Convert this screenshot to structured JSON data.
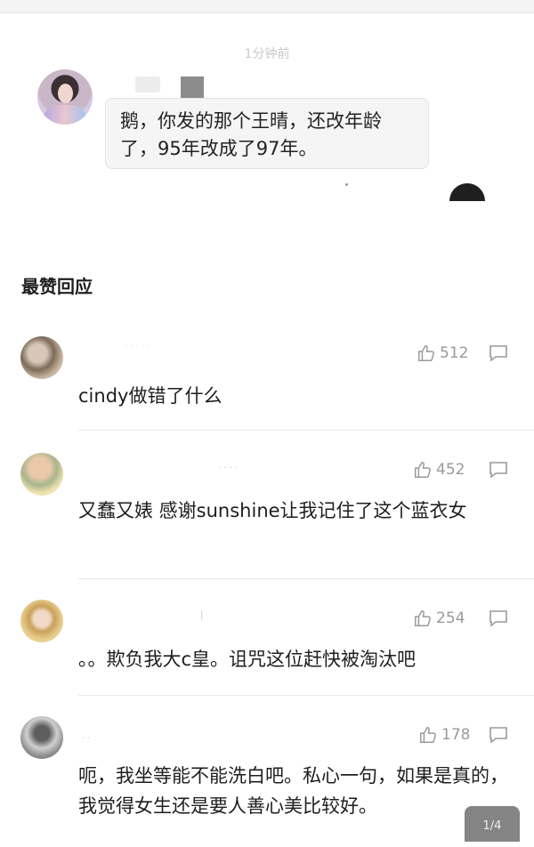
{
  "chat": {
    "timestamp": "1分钟前",
    "message": "鹅，你发的那个王晴，还改年龄了，95年改成了97年。"
  },
  "top_replies": {
    "title": "最赞回应",
    "comments": [
      {
        "likes": "512",
        "text": "cindy做错了什么"
      },
      {
        "likes": "452",
        "text": "又蠢又婊 感谢sunshine让我记住了这个蓝衣女"
      },
      {
        "likes": "254",
        "text": "。。欺负我大c皇。诅咒这位赶快被淘汰吧"
      },
      {
        "likes": "178",
        "text": "呃，我坐等能不能洗白吧。私心一句，如果是真的，我觉得女生还是要人善心美比较好。"
      }
    ]
  },
  "page_indicator": "1/4",
  "colors": {
    "bubble_bg": "#f5f5f5",
    "text": "#1e1e1e",
    "muted": "#9a9a9a"
  }
}
